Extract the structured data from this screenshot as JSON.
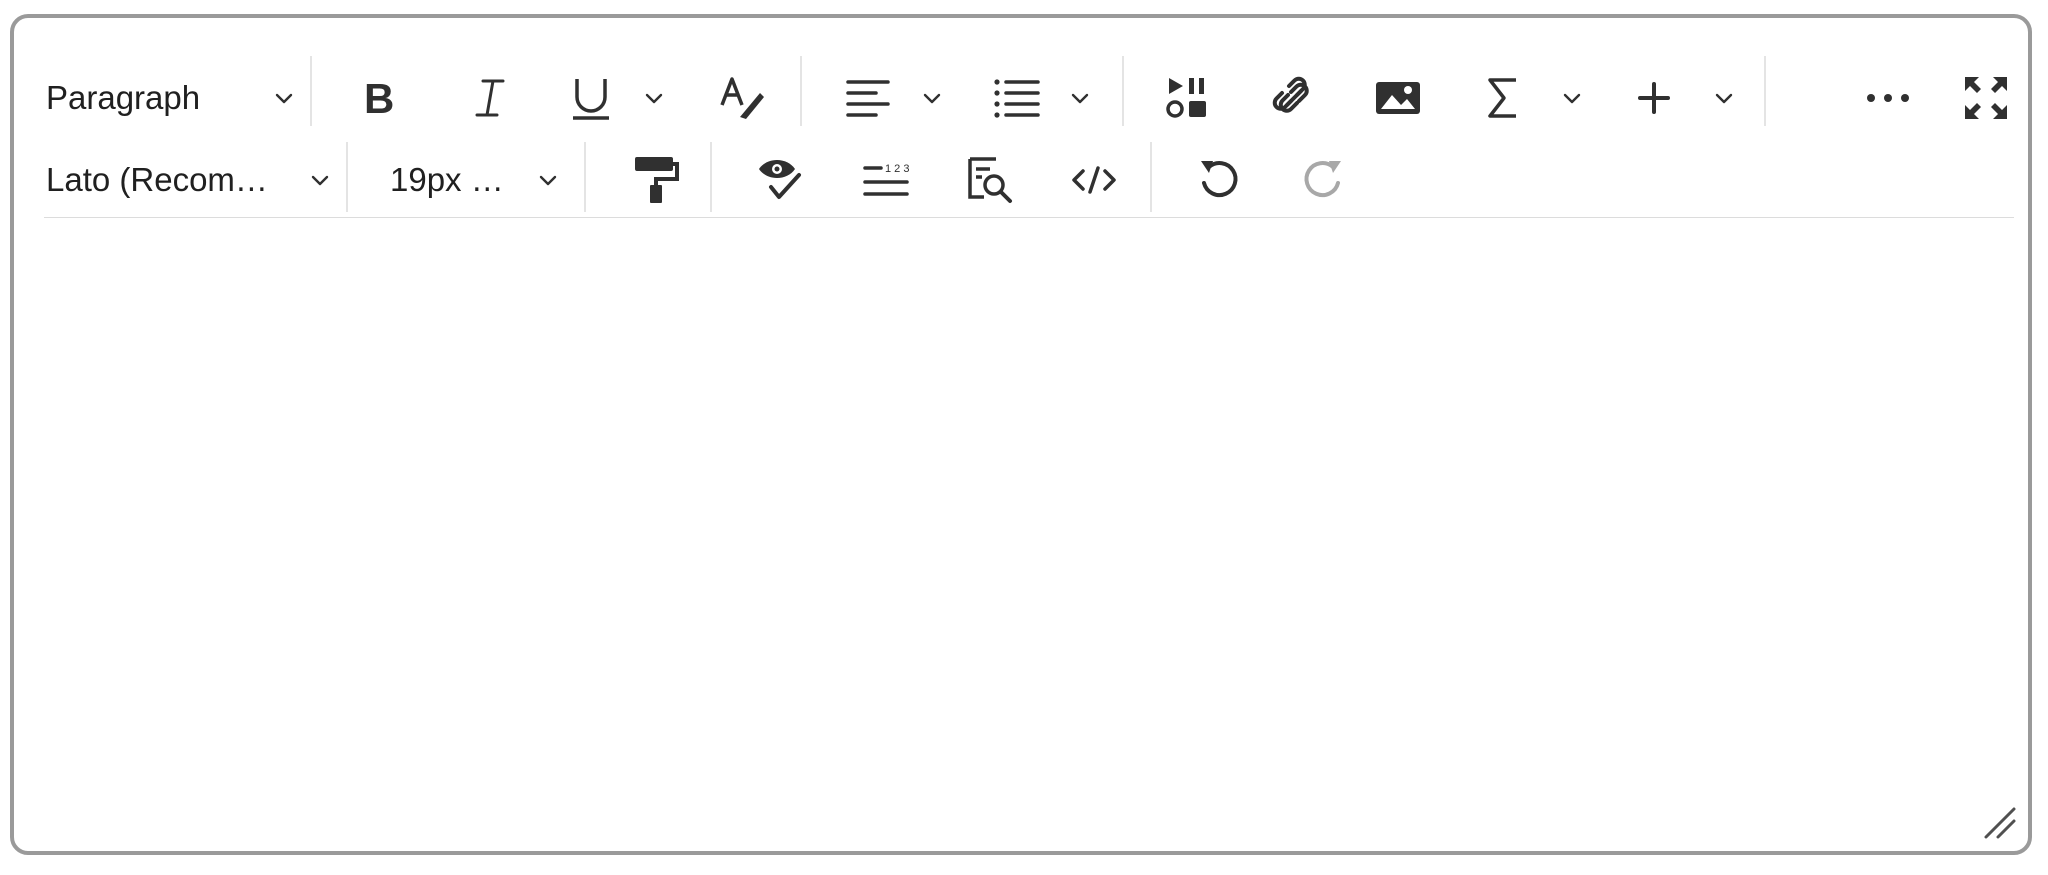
{
  "toolbar": {
    "row1": {
      "block_format": {
        "label": "Paragraph",
        "icon": "chevron-down-icon"
      },
      "bold": {
        "icon": "bold-icon"
      },
      "italic": {
        "icon": "italic-icon"
      },
      "underline": {
        "icon": "underline-icon"
      },
      "clear_formatting": {
        "icon": "clear-formatting-icon"
      },
      "align": {
        "icon": "align-left-icon"
      },
      "list": {
        "icon": "bullet-list-icon"
      },
      "media": {
        "icon": "media-icon"
      },
      "link": {
        "icon": "link-icon"
      },
      "image": {
        "icon": "image-icon"
      },
      "equation": {
        "icon": "sigma-icon"
      },
      "insert": {
        "icon": "plus-icon"
      },
      "more": {
        "icon": "more-horizontal-icon"
      },
      "fullscreen": {
        "icon": "fullscreen-icon"
      }
    },
    "row2": {
      "font_family": {
        "label": "Lato (Recom…",
        "icon": "chevron-down-icon"
      },
      "font_size": {
        "label": "19px …",
        "icon": "chevron-down-icon"
      },
      "format_painter": {
        "icon": "format-painter-icon"
      },
      "accessibility_check": {
        "icon": "accessibility-check-icon"
      },
      "word_count": {
        "icon": "word-count-icon"
      },
      "preview": {
        "icon": "preview-search-icon"
      },
      "source_code": {
        "icon": "code-icon"
      },
      "undo": {
        "icon": "undo-icon"
      },
      "redo": {
        "icon": "redo-icon",
        "disabled": true
      }
    }
  },
  "editor": {
    "content": ""
  },
  "colors": {
    "border": "#9a9a9a",
    "icon": "#303030",
    "icon_disabled": "#a8a8a8",
    "separator": "#e4e4e4"
  }
}
